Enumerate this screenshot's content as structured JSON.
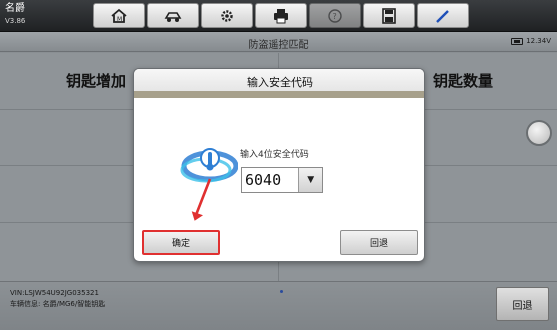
{
  "app": {
    "name": "名爵",
    "version": "V3.86"
  },
  "toolbar": {
    "items": [
      {
        "name": "home",
        "icon": "home-icon"
      },
      {
        "name": "vehicle",
        "icon": "car-icon"
      },
      {
        "name": "settings",
        "icon": "gear-icon"
      },
      {
        "name": "print",
        "icon": "printer-icon"
      },
      {
        "name": "help",
        "icon": "help-icon",
        "disabled": true
      },
      {
        "name": "save",
        "icon": "save-icon"
      },
      {
        "name": "edit",
        "icon": "pen-icon"
      }
    ]
  },
  "header": {
    "title": "防盗遥控匹配",
    "battery": "12.34V"
  },
  "main": {
    "left_label": "钥匙增加",
    "right_label": "钥匙数量"
  },
  "dialog": {
    "title": "输入安全代码",
    "prompt": "输入4位安全代码",
    "code_value": "6040",
    "ok_label": "确定",
    "back_label": "回退"
  },
  "footer": {
    "vin": "VIN:LSJW54U92JG035321",
    "vehicle_info": "车辆信息: 名爵/MG6/智能钥匙",
    "back_label": "回退"
  },
  "colors": {
    "highlight": "#e03030",
    "toolbar_bg": "#2b2d30",
    "dim_bg": "#8f9498",
    "annotation_arrow": "#e03030"
  }
}
